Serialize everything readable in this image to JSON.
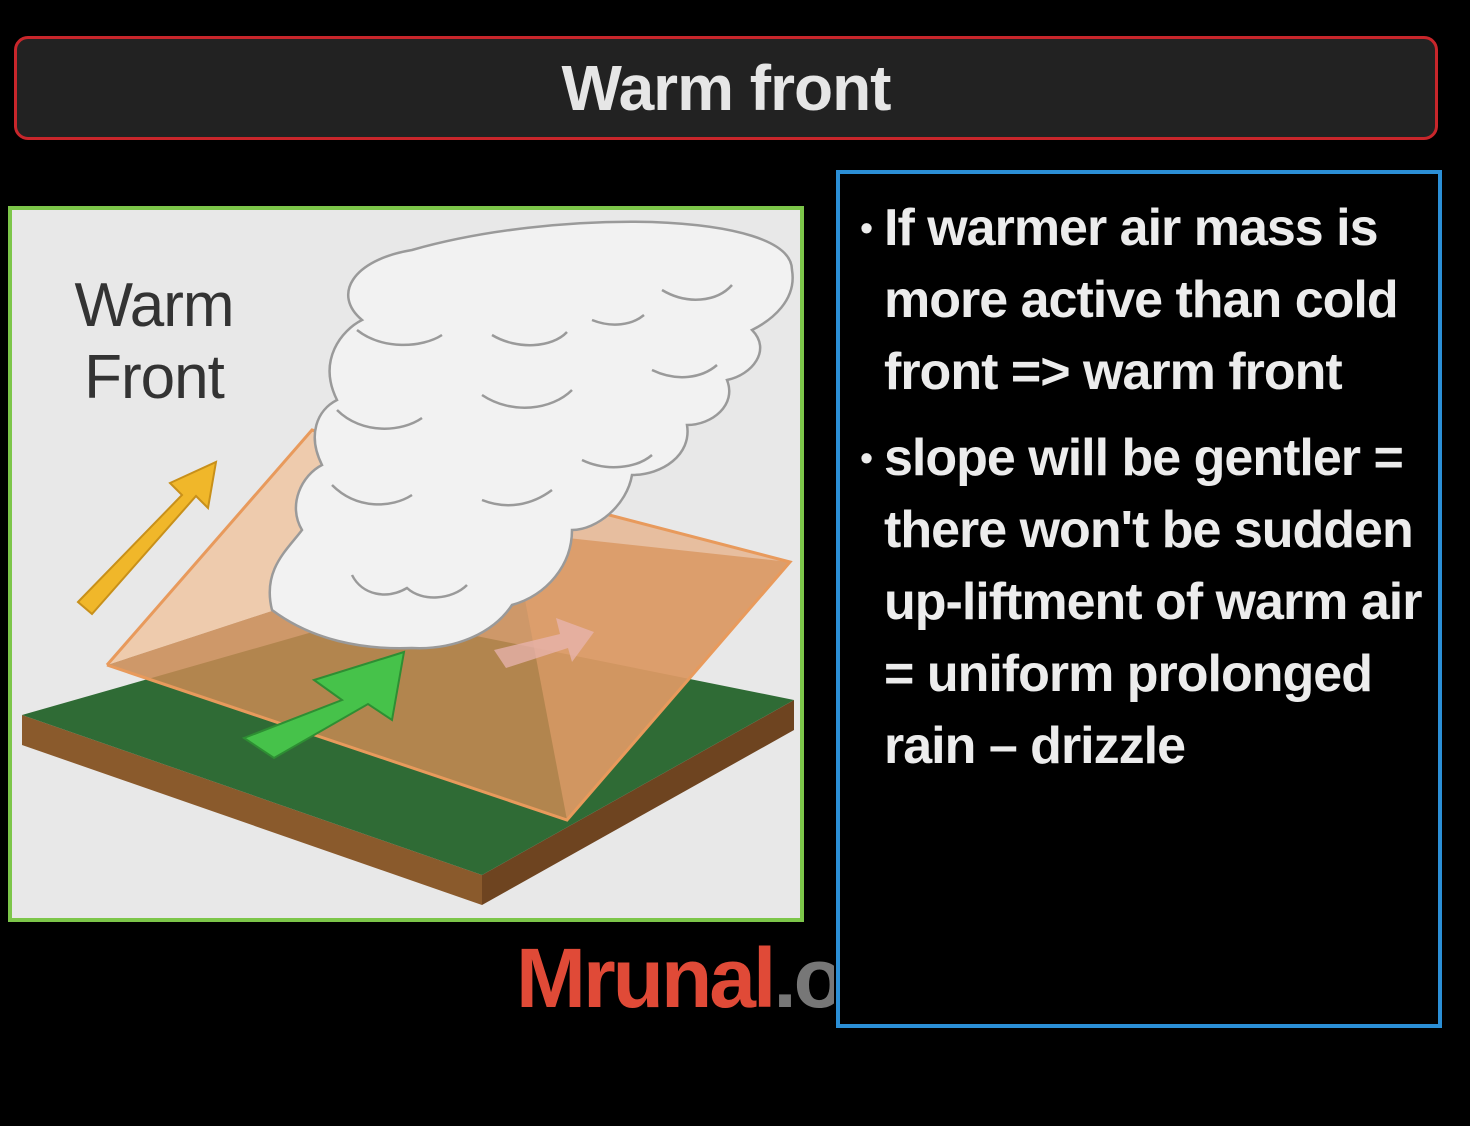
{
  "slide": {
    "title": "Warm front"
  },
  "figure": {
    "label_line1": "Warm",
    "label_line2": "Front",
    "colors": {
      "border": "#7dc64a",
      "ground_green": "#2f6b35",
      "ground_soil": "#8a5a2c",
      "warm_air_wedge": "#e0a06a",
      "cloud": "#f2f2f2",
      "yellow_arrow": "#f0b72a",
      "green_arrow": "#46c24a",
      "pink_arrow": "#e8b4b0"
    }
  },
  "notes": {
    "bullets": [
      "If warmer air mass is more active than cold front => warm front",
      "slope will be gentler = there won't be sudden up-liftment of warm air = uniform prolonged rain – drizzle"
    ]
  },
  "watermark": {
    "main": "Mrunal",
    "rest": ".org"
  }
}
